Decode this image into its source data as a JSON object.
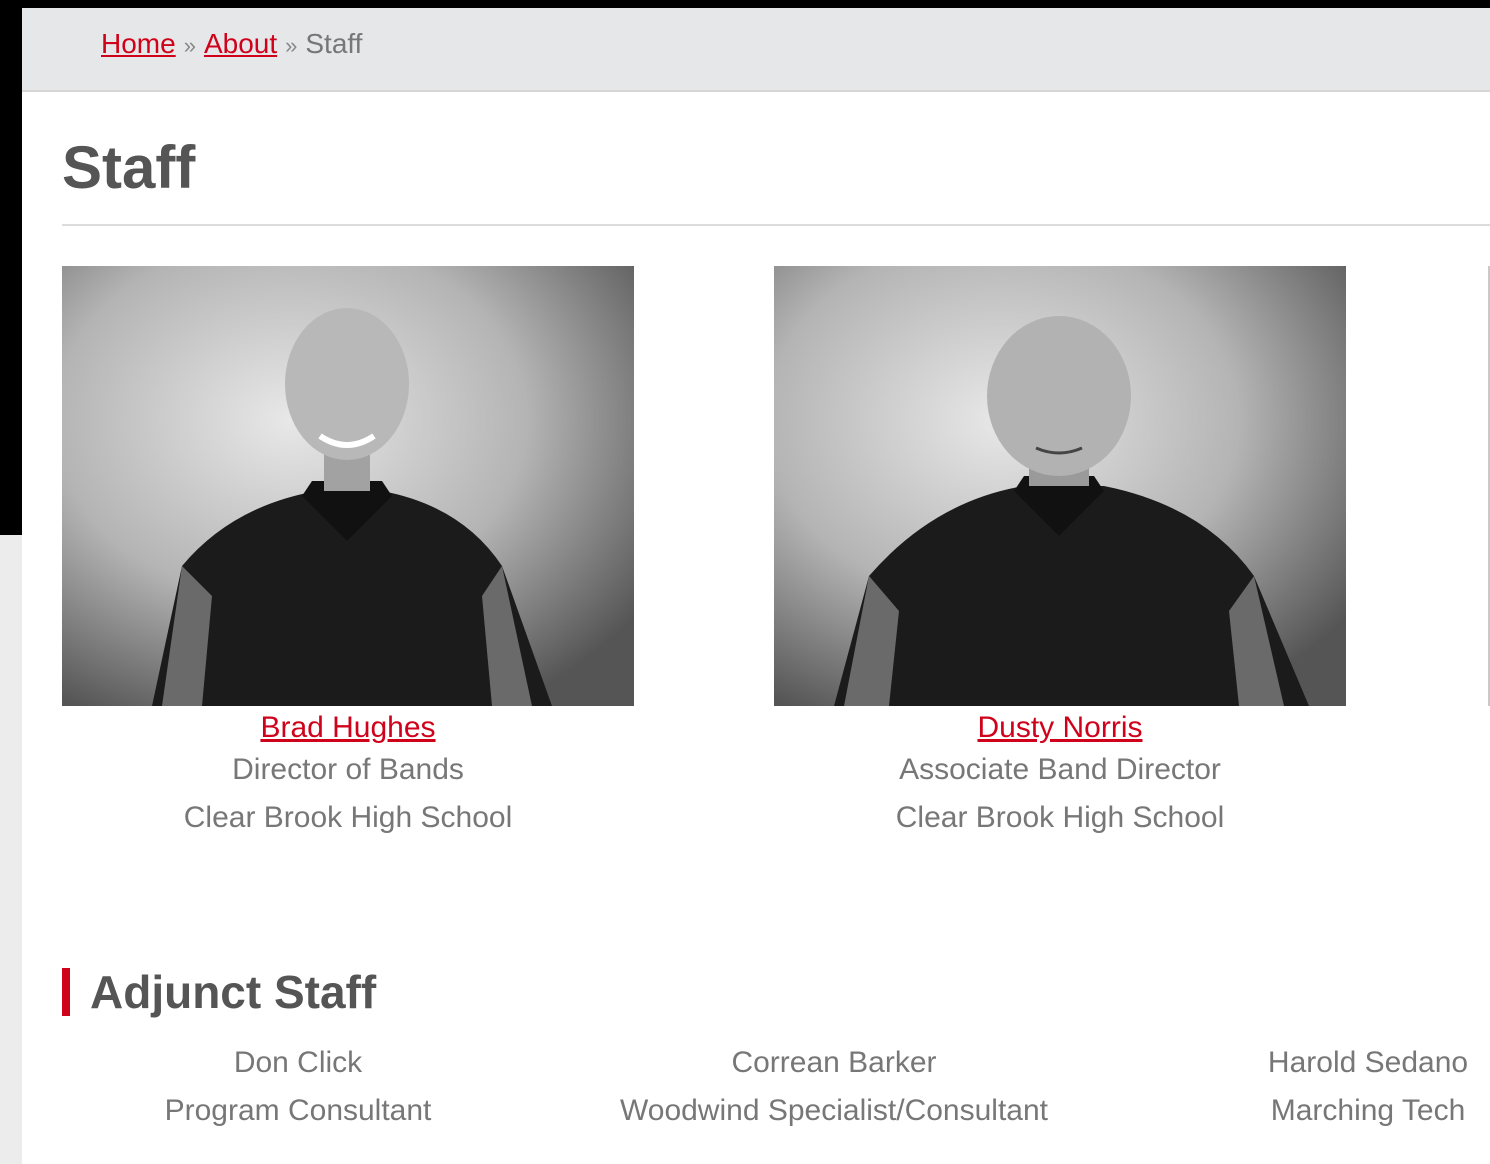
{
  "breadcrumb": {
    "home": "Home",
    "separator": "»",
    "about": "About",
    "current": "Staff"
  },
  "page_title": "Staff",
  "staff": [
    {
      "name": "Brad Hughes",
      "role": "Director of Bands",
      "school": "Clear Brook High School",
      "photo": "staff-photo-brad-hughes"
    },
    {
      "name": "Dusty Norris",
      "role": "Associate Band Director",
      "school": "Clear Brook High School",
      "photo": "staff-photo-dusty-norris"
    }
  ],
  "adjunct": {
    "heading": "Adjunct Staff",
    "members": [
      {
        "name": "Don Click",
        "role": "Program Consultant"
      },
      {
        "name": "Correan Barker",
        "role": "Woodwind Specialist/Consultant"
      },
      {
        "name": "Harold Sedano",
        "role": "Marching Tech"
      }
    ]
  },
  "colors": {
    "accent": "#d0021b",
    "text": "#777777",
    "heading": "#555555",
    "breadcrumb_bg": "#e6e7e8"
  }
}
